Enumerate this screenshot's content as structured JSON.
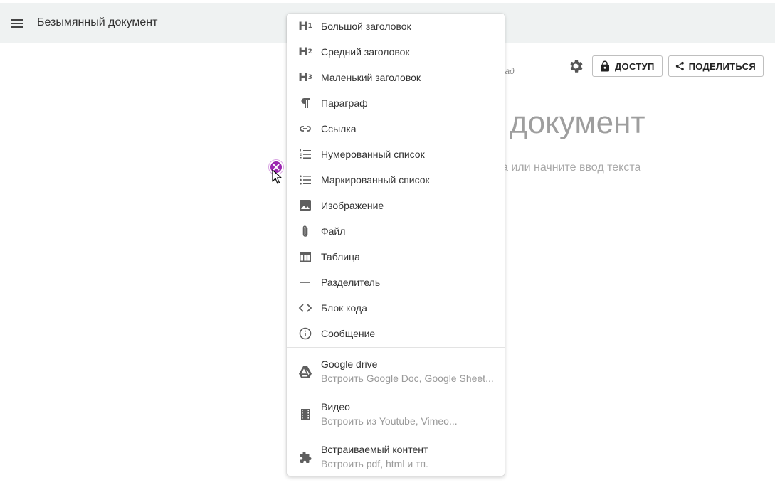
{
  "header": {
    "doc_title": "Безымянный документ",
    "menu_icon": "hamburger-icon"
  },
  "toolbar": {
    "nav_link": "зад",
    "settings_icon": "gear-icon",
    "access_label": "ДОСТУП",
    "access_icon": "lock-icon",
    "share_label": "ПОДЕЛИТЬСЯ",
    "share_icon": "share-icon"
  },
  "document": {
    "heading": "документ",
    "placeholder": "а или начните ввод текста"
  },
  "insert_menu": {
    "items": [
      {
        "label": "Большой заголовок",
        "icon": "heading1-icon"
      },
      {
        "label": "Средний заголовок",
        "icon": "heading2-icon"
      },
      {
        "label": "Маленький заголовок",
        "icon": "heading3-icon"
      },
      {
        "label": "Параграф",
        "icon": "paragraph-icon"
      },
      {
        "label": "Ссылка",
        "icon": "link-icon"
      },
      {
        "label": "Нумерованный список",
        "icon": "numbered-list-icon"
      },
      {
        "label": "Маркированный список",
        "icon": "bulleted-list-icon"
      },
      {
        "label": "Изображение",
        "icon": "image-icon"
      },
      {
        "label": "Файл",
        "icon": "paperclip-icon"
      },
      {
        "label": "Таблица",
        "icon": "table-icon"
      },
      {
        "label": "Разделитель",
        "icon": "divider-icon"
      },
      {
        "label": "Блок кода",
        "icon": "code-icon"
      },
      {
        "label": "Сообщение",
        "icon": "info-icon"
      }
    ],
    "embeds": [
      {
        "label": "Google drive",
        "sub": "Встроить Google Doc, Google Sheet...",
        "icon": "google-drive-icon"
      },
      {
        "label": "Видео",
        "sub": "Встроить из Youtube, Vimeo...",
        "icon": "film-icon"
      },
      {
        "label": "Встраиваемый контент",
        "sub": "Встроить pdf, html и тп.",
        "icon": "puzzle-icon"
      }
    ]
  },
  "colors": {
    "topbar_bg": "#eff2f2",
    "accent_close": "#9c27b0",
    "icon_gray": "#5f5f5f"
  }
}
